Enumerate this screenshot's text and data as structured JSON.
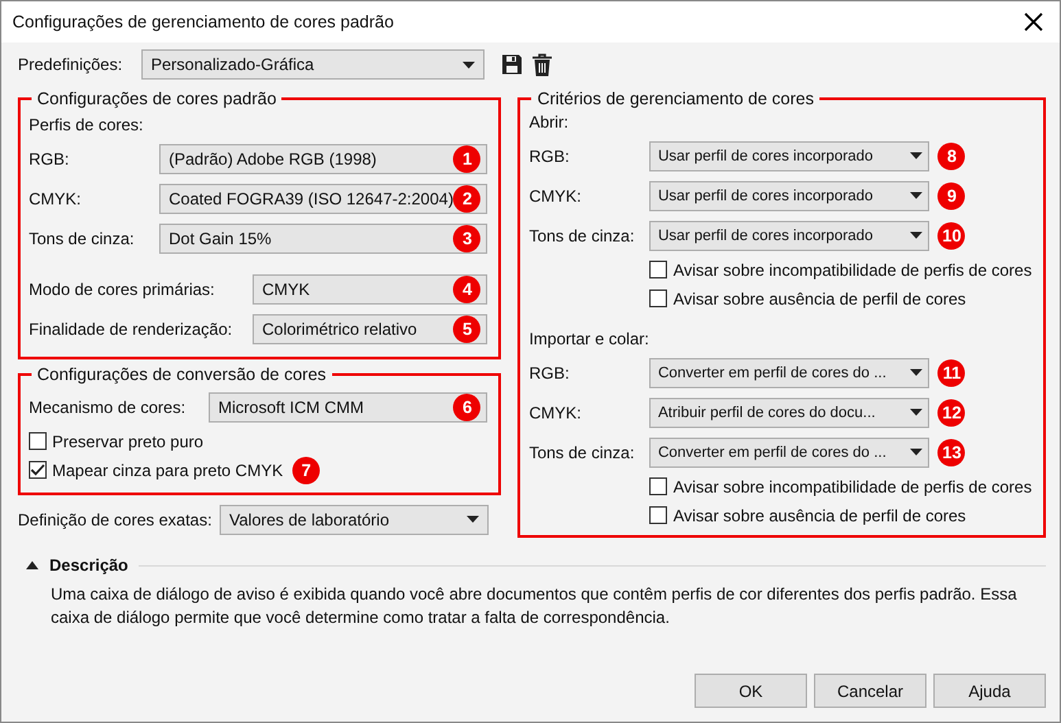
{
  "window": {
    "title": "Configurações de gerenciamento de cores padrão"
  },
  "presets": {
    "label": "Predefinições:",
    "value": "Personalizado-Gráfica"
  },
  "default_colors": {
    "title": "Configurações de cores padrão",
    "subtitle": "Perfis de cores:",
    "profiles": [
      {
        "label": "RGB:",
        "value": "(Padrão) Adobe RGB (1998)",
        "badge": "1"
      },
      {
        "label": "CMYK:",
        "value": "Coated FOGRA39 (ISO 12647-2:2004)",
        "badge": "2"
      },
      {
        "label": "Tons de cinza:",
        "value": "Dot Gain 15%",
        "badge": "3"
      }
    ],
    "modes": [
      {
        "label": "Modo de cores primárias:",
        "value": "CMYK",
        "badge": "4"
      },
      {
        "label": "Finalidade de renderização:",
        "value": "Colorimétrico relativo",
        "badge": "5"
      }
    ]
  },
  "conversion": {
    "title": "Configurações de conversão de cores",
    "engine": {
      "label": "Mecanismo de cores:",
      "value": "Microsoft ICM CMM",
      "badge": "6"
    },
    "checkboxes": [
      {
        "label": "Preservar preto puro",
        "checked": false
      },
      {
        "label": "Mapear cinza para preto CMYK",
        "checked": true,
        "badge": "7"
      }
    ]
  },
  "exact": {
    "label": "Definição de cores exatas:",
    "value": "Valores de laboratório"
  },
  "criteria": {
    "title": "Critérios de gerenciamento de cores",
    "sections": [
      {
        "heading": "Abrir:",
        "rows": [
          {
            "label": "RGB:",
            "value": "Usar perfil de cores incorporado",
            "badge": "8"
          },
          {
            "label": "CMYK:",
            "value": "Usar perfil de cores incorporado",
            "badge": "9"
          },
          {
            "label": "Tons de cinza:",
            "value": "Usar perfil de cores incorporado",
            "badge": "10"
          }
        ],
        "checkboxes": [
          {
            "label": "Avisar sobre incompatibilidade de perfis de cores",
            "checked": false
          },
          {
            "label": "Avisar sobre ausência de perfil de cores",
            "checked": false
          }
        ]
      },
      {
        "heading": "Importar e colar:",
        "rows": [
          {
            "label": "RGB:",
            "value": "Converter em perfil de cores do ...",
            "badge": "11"
          },
          {
            "label": "CMYK:",
            "value": "Atribuir perfil de cores do docu...",
            "badge": "12"
          },
          {
            "label": "Tons de cinza:",
            "value": "Converter em perfil de cores do ...",
            "badge": "13"
          }
        ],
        "checkboxes": [
          {
            "label": "Avisar sobre incompatibilidade de perfis de cores",
            "checked": false
          },
          {
            "label": "Avisar sobre ausência de perfil de cores",
            "checked": false
          }
        ]
      }
    ]
  },
  "description": {
    "heading": "Descrição",
    "expanded": true,
    "text": "Uma caixa de diálogo de aviso é exibida quando você abre documentos que contêm perfis de cor diferentes dos perfis padrão. Essa caixa de diálogo permite que você determine como tratar a falta de correspondência."
  },
  "buttons": [
    "OK",
    "Cancelar",
    "Ajuda"
  ]
}
